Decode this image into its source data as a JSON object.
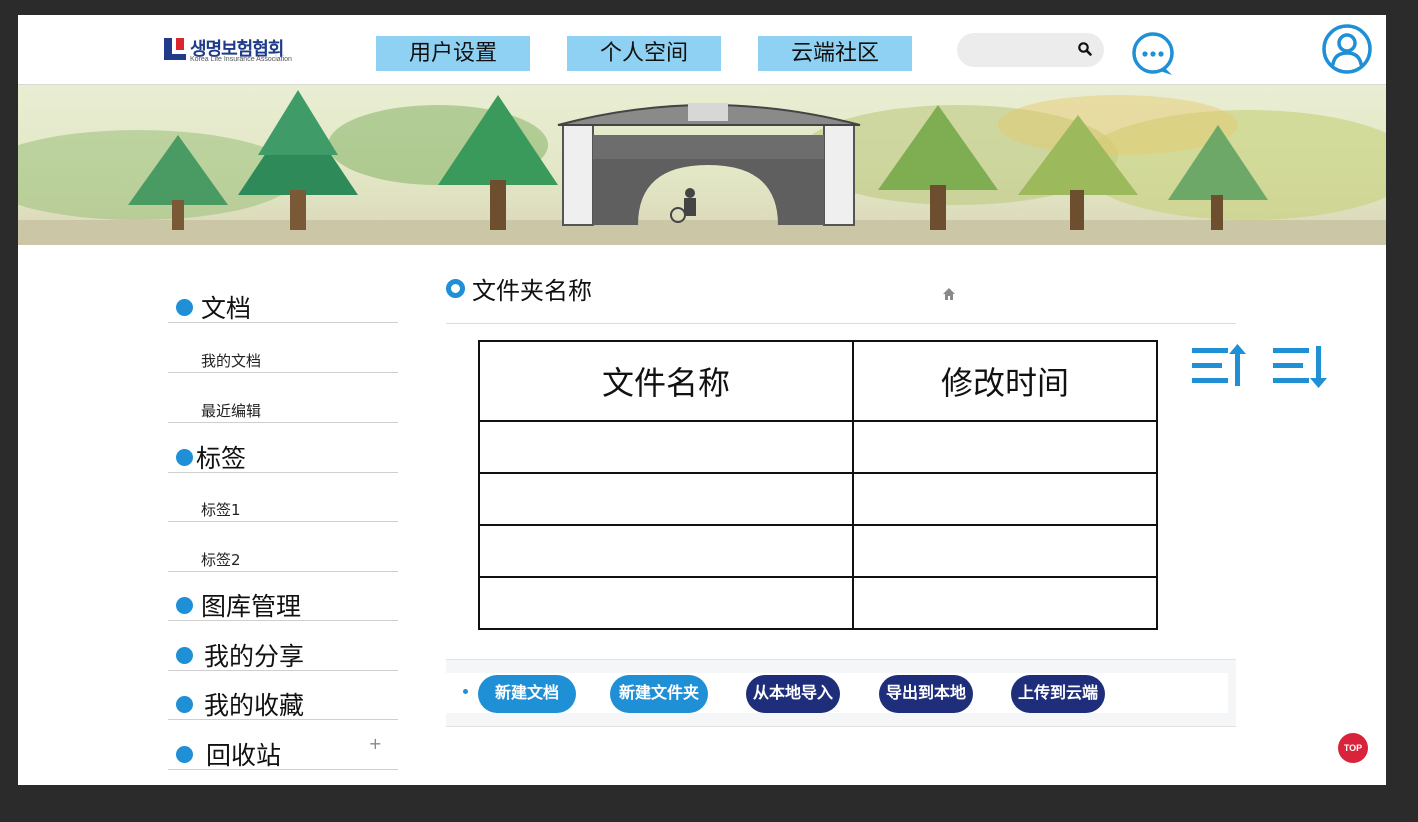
{
  "header": {
    "logo_title": "생명보험협회",
    "logo_subtitle": "Korea Life Insurance Association",
    "nav": [
      "用户设置",
      "个人空间",
      "云端社区"
    ],
    "search_placeholder": ""
  },
  "sidebar": {
    "items": [
      {
        "label": "文档",
        "level": "major"
      },
      {
        "label": "我的文档",
        "level": "minor"
      },
      {
        "label": "最近编辑",
        "level": "minor"
      },
      {
        "label": "标签",
        "level": "major"
      },
      {
        "label": "标签1",
        "level": "minor"
      },
      {
        "label": "标签2",
        "level": "minor"
      },
      {
        "label": "图库管理",
        "level": "major"
      },
      {
        "label": "我的分享",
        "level": "major"
      },
      {
        "label": "我的收藏",
        "level": "major"
      },
      {
        "label": "回收站",
        "level": "major"
      }
    ],
    "plus": "+"
  },
  "main": {
    "folder_title": "文件夹名称",
    "table": {
      "headers": [
        "文件名称",
        "修改时间"
      ],
      "rows": [
        [
          "",
          ""
        ],
        [
          "",
          ""
        ],
        [
          "",
          ""
        ],
        [
          "",
          ""
        ]
      ]
    },
    "actions": [
      "新建文档",
      "新建文件夹",
      "从本地导入",
      "导出到本地",
      "上传到云端"
    ]
  },
  "top_button": "TOP",
  "colors": {
    "accent": "#1f8fd6",
    "nav_bg": "#8fd1f2",
    "dark_button": "#1f2e7a",
    "top_button": "#d8233a"
  },
  "icons": [
    "search-icon",
    "chat-icon",
    "user-icon",
    "home-icon",
    "sort-ascending-icon",
    "sort-descending-icon"
  ]
}
